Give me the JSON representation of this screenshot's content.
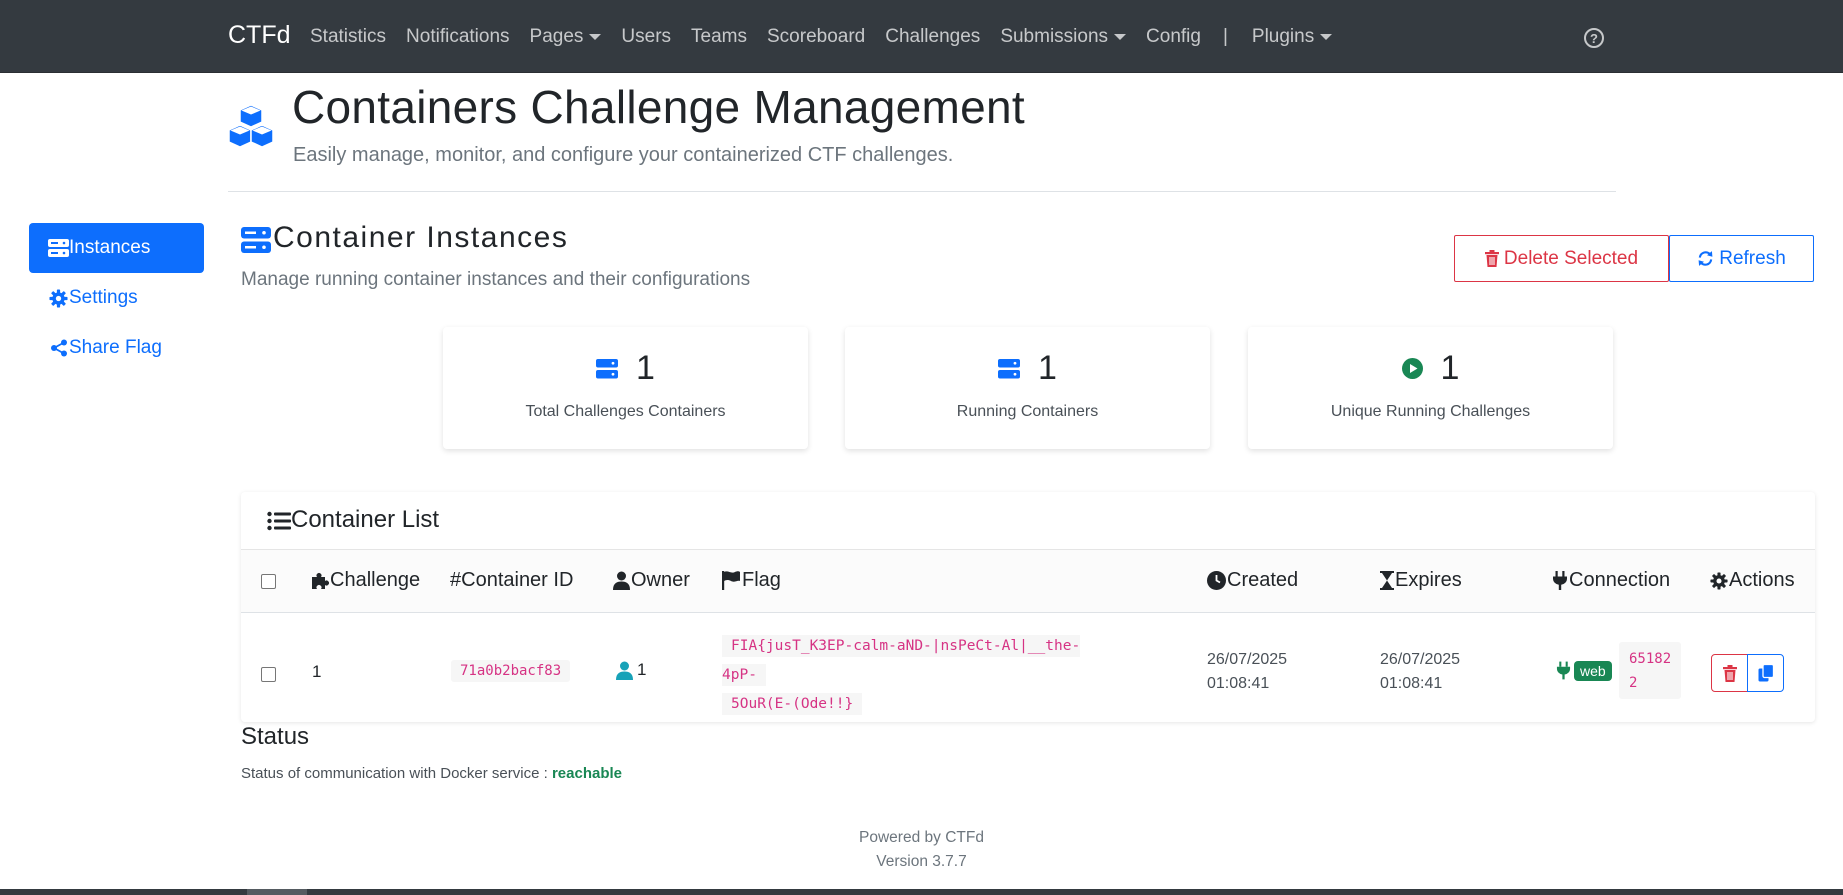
{
  "navbar": {
    "brand": "CTFd",
    "items": [
      {
        "label": "Statistics",
        "dropdown": false
      },
      {
        "label": "Notifications",
        "dropdown": false
      },
      {
        "label": "Pages",
        "dropdown": true
      },
      {
        "label": "Users",
        "dropdown": false
      },
      {
        "label": "Teams",
        "dropdown": false
      },
      {
        "label": "Scoreboard",
        "dropdown": false
      },
      {
        "label": "Challenges",
        "dropdown": false
      },
      {
        "label": "Submissions",
        "dropdown": true
      },
      {
        "label": "Config",
        "dropdown": false
      }
    ],
    "separator": "|",
    "plugins": {
      "label": "Plugins",
      "dropdown": true
    },
    "help_icon": "question-circle-icon"
  },
  "header": {
    "icon": "cubes-icon",
    "title": "Containers Challenge Management",
    "subtitle": "Easily manage, monitor, and configure your containerized CTF challenges."
  },
  "sidebar": {
    "items": [
      {
        "label": "Instances",
        "icon": "server-icon",
        "active": true
      },
      {
        "label": "Settings",
        "icon": "gear-icon",
        "active": false
      },
      {
        "label": "Share Flag",
        "icon": "share-icon",
        "active": false
      }
    ]
  },
  "section": {
    "title": "Container Instances",
    "subtitle": "Manage running container instances and their configurations",
    "delete_label": "Delete Selected",
    "refresh_label": "Refresh"
  },
  "stats": [
    {
      "value": "1",
      "label": "Total Challenges Containers",
      "icon": "server-icon"
    },
    {
      "value": "1",
      "label": "Running Containers",
      "icon": "server-icon"
    },
    {
      "value": "1",
      "label": "Unique Running Challenges",
      "icon": "play-circle-icon"
    }
  ],
  "container_list": {
    "title": "Container List",
    "columns": {
      "challenge": "Challenge",
      "container_id": "Container ID",
      "owner": "Owner",
      "flag": "Flag",
      "created": "Created",
      "expires": "Expires",
      "connection": "Connection",
      "actions": "Actions"
    },
    "rows": [
      {
        "challenge": "1",
        "container_id": "71a0b2bacf83",
        "owner": "1",
        "flag_line1": "FIA{jusT_K3EP-calm-aND-|nsPeCt-Al|__the-4pP-",
        "flag_line2": "5OuR(E-(Ode!!}",
        "created_date": "26/07/2025",
        "created_time": "01:08:41",
        "expires_date": "26/07/2025",
        "expires_time": "01:08:41",
        "connection_type": "web",
        "port_line1": "65182",
        "port_line2": "2"
      }
    ]
  },
  "status": {
    "title": "Status",
    "text": "Status of communication with Docker service : ",
    "value": "reachable"
  },
  "footer": {
    "powered": "Powered by CTFd",
    "version": "Version 3.7.7"
  },
  "colors": {
    "navbar": "#343a40",
    "primary": "#0d6efd",
    "danger": "#dc3545",
    "success": "#198754",
    "code": "#d63384"
  }
}
